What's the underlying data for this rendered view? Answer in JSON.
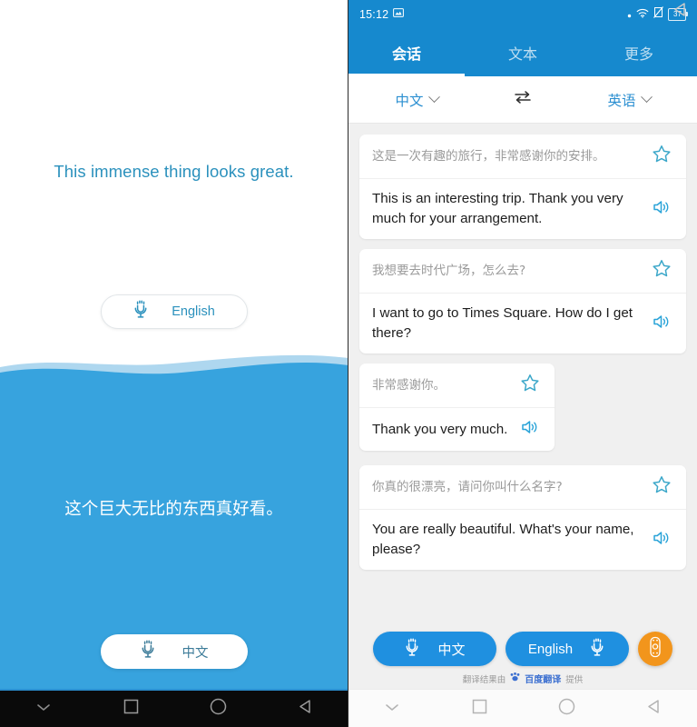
{
  "left_panel": {
    "english_phrase": "This immense thing looks great.",
    "chinese_phrase": "这个巨大无比的东西真好看。",
    "top_mic_label": "English",
    "bottom_mic_label": "中文",
    "top_mic_icon": "microphone-icon",
    "bottom_mic_icon": "microphone-icon",
    "top_bg_color": "#ffffff",
    "bottom_bg_color": "#37a3de",
    "text_color": "#2b91bd",
    "nav": [
      {
        "icon": "chevron-down-icon",
        "name": "hide-navbar-button"
      },
      {
        "icon": "square-icon",
        "name": "recents-button"
      },
      {
        "icon": "circle-icon",
        "name": "home-button"
      },
      {
        "icon": "triangle-left-icon",
        "name": "back-button"
      }
    ]
  },
  "right_panel": {
    "status_bar": {
      "time": "15:12",
      "time_icon": "screenshot-icon",
      "indicators": [
        "dot-icon",
        "wifi-icon",
        "signal-off-icon"
      ],
      "battery_level": "37"
    },
    "tabs": [
      {
        "label": "会话",
        "active": true
      },
      {
        "label": "文本",
        "active": false
      },
      {
        "label": "更多",
        "active": false
      }
    ],
    "language_bar": {
      "source": "中文",
      "target": "英语",
      "swap_icon": "swap-arrows-icon",
      "source_chevron": "chevron-down-icon",
      "target_chevron": "chevron-down-icon"
    },
    "conversation": [
      {
        "source": "这是一次有趣的旅行，非常感谢你的安排。",
        "translation": "This is an interesting trip. Thank you very much for your arrangement.",
        "star_icon": "star-outline-icon",
        "speaker_icon": "speaker-icon",
        "fit": false
      },
      {
        "source": "我想要去时代广场，怎么去?",
        "translation": "I want to go to Times Square. How do I get there?",
        "star_icon": "star-outline-icon",
        "speaker_icon": "speaker-icon",
        "fit": false
      },
      {
        "source": "非常感谢你。",
        "translation": "Thank you very much.",
        "star_icon": "star-outline-icon",
        "speaker_icon": "speaker-icon",
        "fit": true
      },
      {
        "source": "你真的很漂亮，请问你叫什么名字?",
        "translation": "You are really beautiful. What's your name, please?",
        "star_icon": "star-outline-icon",
        "speaker_icon": "speaker-icon",
        "fit": false
      }
    ],
    "bottom_bar": {
      "cn_button_label": "中文",
      "en_button_label": "English",
      "cn_mic_icon": "microphone-icon",
      "en_mic_icon": "microphone-icon",
      "fab_icon": "remote-control-icon",
      "fab_color": "#f2951c",
      "credit_prefix": "翻译结果由",
      "credit_brand": "百度翻译",
      "credit_suffix": "提供"
    },
    "nav": [
      {
        "icon": "chevron-down-icon",
        "name": "hide-navbar-button"
      },
      {
        "icon": "square-icon",
        "name": "recents-button"
      },
      {
        "icon": "circle-icon",
        "name": "home-button"
      },
      {
        "icon": "triangle-left-icon",
        "name": "back-button"
      }
    ],
    "accent_color": "#1689ce",
    "card_bg_color": "#ffffff",
    "scroll_bg_color": "#f0f0f0"
  }
}
